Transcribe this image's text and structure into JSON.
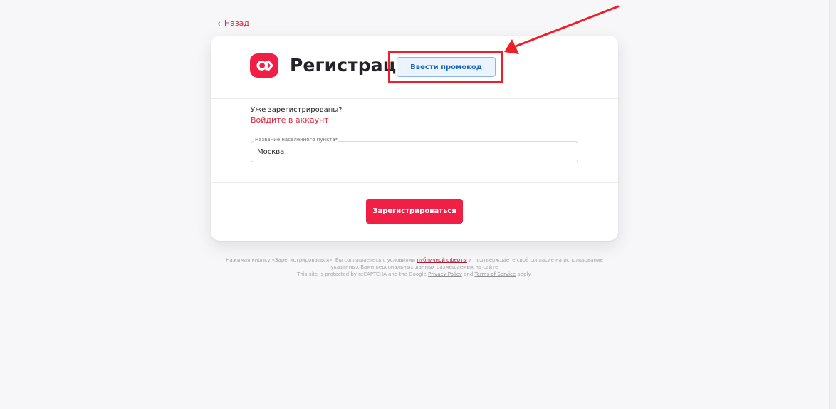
{
  "navigation": {
    "back_label": "Назад"
  },
  "header": {
    "title": "Регистрация",
    "promo_button_label": "Ввести промокод"
  },
  "account": {
    "already_registered": "Уже зарегистрированы?",
    "login_link": "Войдите в аккаунт"
  },
  "city_field": {
    "label": "Название населенного пункта*",
    "value": "Москва"
  },
  "actions": {
    "register_label": "Зарегистрироваться"
  },
  "legal": {
    "text_prefix": "Нажимая кнопку «Зарегистрироваться», Вы соглашаетесь с условиями",
    "offer_link": "публичной оферты",
    "text_suffix": "и подтверждаете своё согласие на использование указанных Вами персональных данных размещаемых на сайте",
    "recaptcha_prefix": "This site is protected by reCAPTCHA and the Google",
    "privacy_link": "Privacy Policy",
    "and_text": "and",
    "terms_link": "Terms of Service",
    "apply_text": "apply."
  },
  "colors": {
    "brand_red": "#ef1f45",
    "promo_blue": "#1d67b8",
    "annotation_red": "#ef1f2a"
  },
  "icons": {
    "logo": "brand-logo-icon",
    "back": "chevron-left-icon"
  }
}
